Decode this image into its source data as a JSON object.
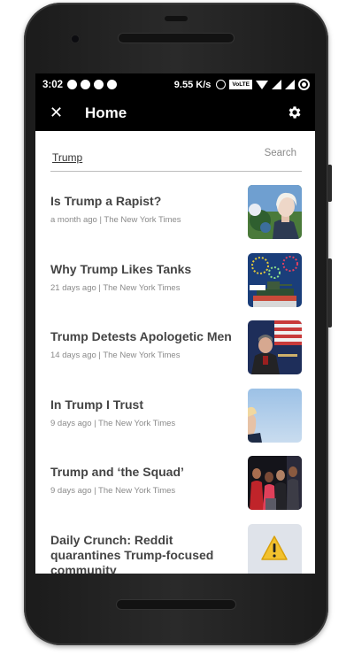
{
  "statusbar": {
    "time": "3:02",
    "net_speed": "9.55 K/s",
    "volte": "VoLTE"
  },
  "appbar": {
    "title": "Home",
    "close_icon": "close-icon",
    "settings_icon": "gear-icon"
  },
  "search": {
    "query": "Trump",
    "button_label": "Search"
  },
  "articles": [
    {
      "title": "Is Trump a Rapist?",
      "meta": "a month ago | The New York Times",
      "thumb": "woman-portrait"
    },
    {
      "title": "Why Trump Likes Tanks",
      "meta": "21 days ago | The New York Times",
      "thumb": "tank-fireworks"
    },
    {
      "title": "Trump Detests Apologetic Men",
      "meta": "14 days ago | The New York Times",
      "thumb": "man-at-podium-flag"
    },
    {
      "title": "In Trump I Trust",
      "meta": "9 days ago | The New York Times",
      "thumb": "sky-portrait"
    },
    {
      "title": "Trump and ‘the Squad’",
      "meta": "9 days ago | The New York Times",
      "thumb": "group-at-podium"
    },
    {
      "title": "Daily Crunch: Reddit quarantines Trump-focused community",
      "meta": "",
      "thumb": "warning-icon"
    }
  ]
}
